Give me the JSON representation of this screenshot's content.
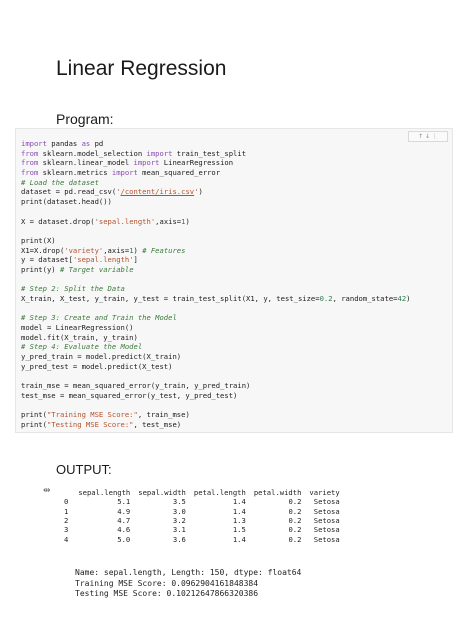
{
  "title": "Linear Regression",
  "program_label": "Program:",
  "output_label": "OUTPUT:",
  "cell_toolbar": "↑ ↓ ⋮",
  "code_lines": [
    [
      {
        "t": "kw",
        "v": "import"
      },
      {
        "t": "",
        "v": " pandas "
      },
      {
        "t": "kw",
        "v": "as"
      },
      {
        "t": "",
        "v": " pd"
      }
    ],
    [
      {
        "t": "kw",
        "v": "from"
      },
      {
        "t": "",
        "v": " sklearn.model_selection "
      },
      {
        "t": "kw",
        "v": "import"
      },
      {
        "t": "",
        "v": " train_test_split"
      }
    ],
    [
      {
        "t": "kw",
        "v": "from"
      },
      {
        "t": "",
        "v": " sklearn.linear_model "
      },
      {
        "t": "kw",
        "v": "import"
      },
      {
        "t": "",
        "v": " LinearRegression"
      }
    ],
    [
      {
        "t": "kw",
        "v": "from"
      },
      {
        "t": "",
        "v": " sklearn.metrics "
      },
      {
        "t": "kw",
        "v": "import"
      },
      {
        "t": "",
        "v": " mean_squared_error"
      }
    ],
    [
      {
        "t": "cm",
        "v": "# Load the dataset"
      }
    ],
    [
      {
        "t": "",
        "v": "dataset = pd.read_csv("
      },
      {
        "t": "st",
        "v": "'"
      },
      {
        "t": "st ul",
        "v": "/content/iris.csv"
      },
      {
        "t": "st",
        "v": "'"
      },
      {
        "t": "",
        "v": ")"
      }
    ],
    [
      {
        "t": "",
        "v": "print(dataset.head())"
      }
    ],
    [
      {
        "t": "",
        "v": ""
      }
    ],
    [
      {
        "t": "",
        "v": "X = dataset.drop("
      },
      {
        "t": "st",
        "v": "'sepal.length'"
      },
      {
        "t": "",
        "v": ",axis="
      },
      {
        "t": "nm",
        "v": "1"
      },
      {
        "t": "",
        "v": ")"
      }
    ],
    [
      {
        "t": "",
        "v": ""
      }
    ],
    [
      {
        "t": "",
        "v": "print(X)"
      }
    ],
    [
      {
        "t": "",
        "v": "X1=X.drop("
      },
      {
        "t": "st",
        "v": "'variety'"
      },
      {
        "t": "",
        "v": ",axis="
      },
      {
        "t": "nm",
        "v": "1"
      },
      {
        "t": "",
        "v": ") "
      },
      {
        "t": "cm",
        "v": "# Features"
      }
    ],
    [
      {
        "t": "",
        "v": "y = dataset["
      },
      {
        "t": "st",
        "v": "'sepal.length'"
      },
      {
        "t": "",
        "v": "]"
      }
    ],
    [
      {
        "t": "",
        "v": "print(y) "
      },
      {
        "t": "cm",
        "v": "# Target variable"
      }
    ],
    [
      {
        "t": "",
        "v": ""
      }
    ],
    [
      {
        "t": "cm",
        "v": "# Step 2: Split the Data"
      }
    ],
    [
      {
        "t": "",
        "v": "X_train, X_test, y_train, y_test = train_test_split(X1, y, test_size="
      },
      {
        "t": "nm",
        "v": "0.2"
      },
      {
        "t": "",
        "v": ", random_state="
      },
      {
        "t": "nm",
        "v": "42"
      },
      {
        "t": "",
        "v": ")"
      }
    ],
    [
      {
        "t": "",
        "v": ""
      }
    ],
    [
      {
        "t": "cm",
        "v": "# Step 3: Create and Train the Model"
      }
    ],
    [
      {
        "t": "",
        "v": "model = LinearRegression()"
      }
    ],
    [
      {
        "t": "",
        "v": "model.fit(X_train, y_train)"
      }
    ],
    [
      {
        "t": "cm",
        "v": "# Step 4: Evaluate the Model"
      }
    ],
    [
      {
        "t": "",
        "v": "y_pred_train = model.predict(X_train)"
      }
    ],
    [
      {
        "t": "",
        "v": "y_pred_test = model.predict(X_test)"
      }
    ],
    [
      {
        "t": "",
        "v": ""
      }
    ],
    [
      {
        "t": "",
        "v": "train_mse = mean_squared_error(y_train, y_pred_train)"
      }
    ],
    [
      {
        "t": "",
        "v": "test_mse = mean_squared_error(y_test, y_pred_test)"
      }
    ],
    [
      {
        "t": "",
        "v": ""
      }
    ],
    [
      {
        "t": "",
        "v": "print("
      },
      {
        "t": "st",
        "v": "\"Training MSE Score:\""
      },
      {
        "t": "",
        "v": ", train_mse)"
      }
    ],
    [
      {
        "t": "",
        "v": "print("
      },
      {
        "t": "st",
        "v": "\"Testing MSE Score:\""
      },
      {
        "t": "",
        "v": ", test_mse)"
      }
    ]
  ],
  "output_table": {
    "columns": [
      "sepal.length",
      "sepal.width",
      "petal.length",
      "petal.width",
      "variety"
    ],
    "rows": [
      {
        "index": "0",
        "values": [
          "5.1",
          "3.5",
          "1.4",
          "0.2",
          "Setosa"
        ]
      },
      {
        "index": "1",
        "values": [
          "4.9",
          "3.0",
          "1.4",
          "0.2",
          "Setosa"
        ]
      },
      {
        "index": "2",
        "values": [
          "4.7",
          "3.2",
          "1.3",
          "0.2",
          "Setosa"
        ]
      },
      {
        "index": "3",
        "values": [
          "4.6",
          "3.1",
          "1.5",
          "0.2",
          "Setosa"
        ]
      },
      {
        "index": "4",
        "values": [
          "5.0",
          "3.6",
          "1.4",
          "0.2",
          "Setosa"
        ]
      }
    ]
  },
  "output_text": [
    "Name: sepal.length, Length: 150, dtype: float64",
    "Training MSE Score: 0.0962904161848384",
    "Testing MSE Score: 0.10212647866320386"
  ],
  "icons": {
    "output": "output-toggle-icon"
  },
  "colors": {
    "keyword": "#8a4bb5",
    "comment": "#3c7a3c",
    "string": "#b5522b",
    "number": "#2e7d4f",
    "cell_bg": "#f7f7f7"
  }
}
